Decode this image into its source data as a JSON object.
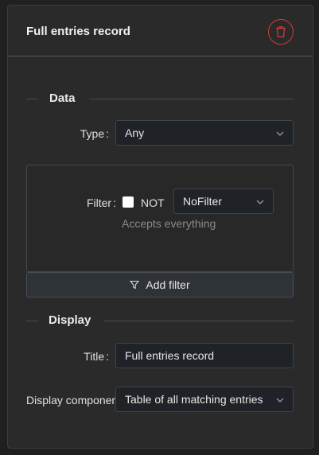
{
  "card": {
    "title": "Full entries record"
  },
  "data_section": {
    "heading": "Data",
    "type_label": "Type",
    "type_value": "Any",
    "filter_label": "Filter",
    "not_label": "NOT",
    "filter_value": "NoFilter",
    "filter_hint": "Accepts everything",
    "add_filter_label": "Add filter"
  },
  "display_section": {
    "heading": "Display",
    "title_label": "Title",
    "title_value": "Full entries record",
    "component_label": "Display componer",
    "component_value": "Table of all matching entries"
  },
  "colors": {
    "danger": "#d23a3a",
    "background": "#2a2a2a"
  },
  "icons": {
    "delete": "trash-icon",
    "dropdown": "chevron-down-icon",
    "filter": "filter-icon"
  }
}
